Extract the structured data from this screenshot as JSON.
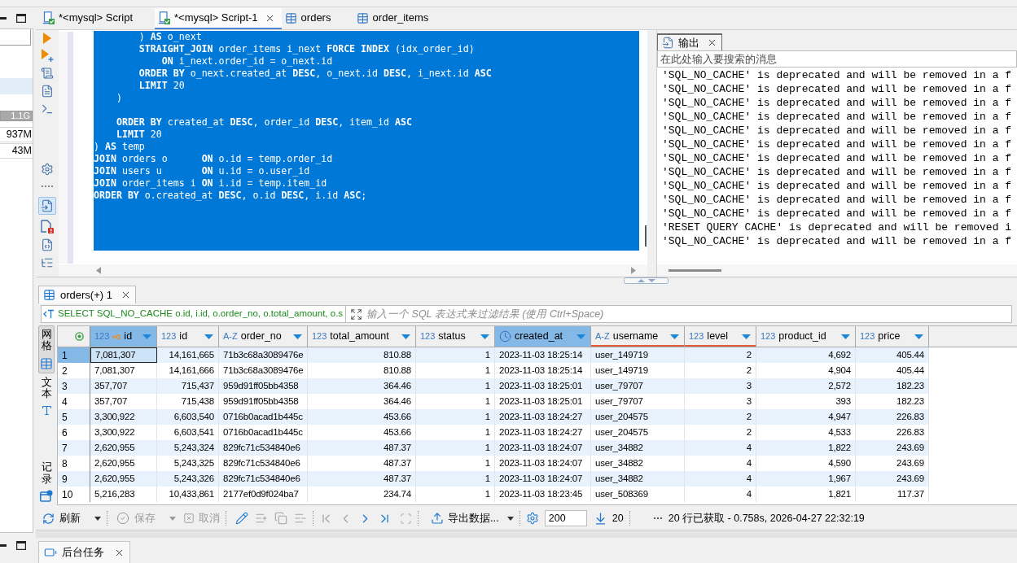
{
  "side_panel": {
    "list_rows": [
      {
        "selected": true
      }
    ],
    "memory": [
      {
        "text": "1.1G",
        "kind": "bar"
      },
      {
        "text": "937M",
        "kind": "value"
      },
      {
        "text": "43M",
        "kind": "value"
      }
    ]
  },
  "editor_tabs": [
    {
      "label": "*<mysql> Script",
      "kind": "script",
      "selected": false,
      "closable": false
    },
    {
      "label": "*<mysql> Script-1",
      "kind": "script",
      "selected": true,
      "closable": true
    },
    {
      "label": "orders",
      "kind": "table",
      "selected": false,
      "closable": false
    },
    {
      "label": "order_items",
      "kind": "table",
      "selected": false,
      "closable": false
    }
  ],
  "editor": {
    "output_toggle": {
      "on": true
    },
    "code_blocks": [
      [
        "        ) **AS** o_next",
        "        **STRAIGHT_JOIN** order_items i_next **FORCE INDEX** (idx_order_id)",
        "            **ON** i_next.order_id = o_next.id",
        "        **ORDER BY** o_next.created_at **DESC**, o_next.id **DESC**, i_next.id **ASC**",
        "        **LIMIT** 20",
        "    )"
      ],
      [
        "    **ORDER BY** created_at **DESC**, order_id **DESC**, item_id **ASC**",
        "    **LIMIT** 20",
        ") **AS** temp",
        "**JOIN** orders o      **ON** o.id = temp.order_id",
        "**JOIN** users u       **ON** u.id = o.user_id",
        "**JOIN** order_items i **ON** i.id = temp.item_id",
        "**ORDER BY** o.created_at **DESC**, o.id **DESC**, i.id **ASC**;"
      ]
    ]
  },
  "output_panel": {
    "tab": {
      "label": "输出",
      "selected": true
    },
    "search": {
      "placeholder": "在此处输入要搜索的消息"
    },
    "messages": [
      "'SQL_NO_CACHE' is deprecated and will be removed in a f",
      "'SQL_NO_CACHE' is deprecated and will be removed in a f",
      "'SQL_NO_CACHE' is deprecated and will be removed in a f",
      "'SQL_NO_CACHE' is deprecated and will be removed in a f",
      "'SQL_NO_CACHE' is deprecated and will be removed in a f",
      "'SQL_NO_CACHE' is deprecated and will be removed in a f",
      "'SQL_NO_CACHE' is deprecated and will be removed in a f",
      "'SQL_NO_CACHE' is deprecated and will be removed in a f",
      "'SQL_NO_CACHE' is deprecated and will be removed in a f",
      "'SQL_NO_CACHE' is deprecated and will be removed in a f",
      "'SQL_NO_CACHE' is deprecated and will be removed in a f",
      "'RESET QUERY CACHE' is deprecated and will be removed i",
      "'SQL_NO_CACHE' is deprecated and will be removed in a f"
    ]
  },
  "results": {
    "tab": {
      "label": "orders(+) 1",
      "selected": true
    },
    "query": "SELECT SQL_NO_CACHE o.id, i.id, o.order_no, o.total_amount, o.s",
    "filter": {
      "placeholder": "输入一个 SQL 表达式来过滤结果 (使用 Ctrl+Space)"
    },
    "view_tabs": [
      {
        "label": "网格",
        "selected": true
      },
      {
        "label": "文本",
        "selected": false
      },
      {
        "label": "记录",
        "selected": false
      }
    ],
    "columns": [
      {
        "label": "id",
        "kind": "number",
        "type_badge": "123",
        "primary_key": true,
        "selected": true,
        "focused": true
      },
      {
        "label": "id",
        "kind": "number",
        "type_badge": "123",
        "primary_key": false,
        "selected": false,
        "focused": false
      },
      {
        "label": "order_no",
        "kind": "string",
        "type_badge": "A-Z",
        "primary_key": false,
        "selected": false,
        "focused": false
      },
      {
        "label": "total_amount",
        "kind": "number",
        "type_badge": "123",
        "primary_key": false,
        "selected": false,
        "focused": false
      },
      {
        "label": "status",
        "kind": "number",
        "type_badge": "123",
        "primary_key": false,
        "selected": false,
        "focused": false
      },
      {
        "label": "created_at",
        "kind": "datetime",
        "primary_key": false,
        "selected": true,
        "focused": false
      },
      {
        "label": "username",
        "kind": "string",
        "type_badge": "A-Z",
        "primary_key": false,
        "selected": false,
        "focused": false,
        "color": "#e25b3c"
      },
      {
        "label": "level",
        "kind": "number",
        "type_badge": "123",
        "primary_key": false,
        "selected": false,
        "focused": false,
        "color": "#e25b3c"
      },
      {
        "label": "product_id",
        "kind": "number",
        "type_badge": "123",
        "primary_key": false,
        "selected": false,
        "focused": false
      },
      {
        "label": "price",
        "kind": "number",
        "type_badge": "123",
        "primary_key": false,
        "selected": false,
        "focused": false
      }
    ],
    "rows": [
      {
        "number": "1",
        "selected": true,
        "cells": [
          "7,081,307",
          "14,161,665",
          "71b3c68a3089476e",
          "810.88",
          "1",
          "2023-11-03 18:25:14",
          "user_149719",
          "2",
          "4,692",
          "405.44"
        ]
      },
      {
        "number": "2",
        "selected": false,
        "cells": [
          "7,081,307",
          "14,161,666",
          "71b3c68a3089476e",
          "810.88",
          "1",
          "2023-11-03 18:25:14",
          "user_149719",
          "2",
          "4,904",
          "405.44"
        ]
      },
      {
        "number": "3",
        "selected": false,
        "cells": [
          "357,707",
          "715,437",
          "959d91ff05bb4358",
          "364.46",
          "1",
          "2023-11-03 18:25:01",
          "user_79707",
          "3",
          "2,572",
          "182.23"
        ]
      },
      {
        "number": "4",
        "selected": false,
        "cells": [
          "357,707",
          "715,438",
          "959d91ff05bb4358",
          "364.46",
          "1",
          "2023-11-03 18:25:01",
          "user_79707",
          "3",
          "393",
          "182.23"
        ]
      },
      {
        "number": "5",
        "selected": false,
        "cells": [
          "3,300,922",
          "6,603,540",
          "0716b0acad1b445c",
          "453.66",
          "1",
          "2023-11-03 18:24:27",
          "user_204575",
          "2",
          "4,947",
          "226.83"
        ]
      },
      {
        "number": "6",
        "selected": false,
        "cells": [
          "3,300,922",
          "6,603,541",
          "0716b0acad1b445c",
          "453.66",
          "1",
          "2023-11-03 18:24:27",
          "user_204575",
          "2",
          "4,533",
          "226.83"
        ]
      },
      {
        "number": "7",
        "selected": false,
        "cells": [
          "2,620,955",
          "5,243,324",
          "829fc71c534840e6",
          "487.37",
          "1",
          "2023-11-03 18:24:07",
          "user_34882",
          "4",
          "1,822",
          "243.69"
        ]
      },
      {
        "number": "8",
        "selected": false,
        "cells": [
          "2,620,955",
          "5,243,325",
          "829fc71c534840e6",
          "487.37",
          "1",
          "2023-11-03 18:24:07",
          "user_34882",
          "4",
          "4,590",
          "243.69"
        ]
      },
      {
        "number": "9",
        "selected": false,
        "cells": [
          "2,620,955",
          "5,243,326",
          "829fc71c534840e6",
          "487.37",
          "1",
          "2023-11-03 18:24:07",
          "user_34882",
          "4",
          "1,967",
          "243.69"
        ]
      },
      {
        "number": "10",
        "selected": false,
        "cells": [
          "5,216,283",
          "10,433,861",
          "2177ef0d9f024ba7",
          "234.74",
          "1",
          "2023-11-03 18:23:45",
          "user_508369",
          "4",
          "1,821",
          "117.37"
        ]
      }
    ]
  },
  "toolbar": {
    "refresh": {
      "label": "刷新",
      "disabled": false
    },
    "save": {
      "label": "保存",
      "disabled": true
    },
    "cancel": {
      "label": "取消",
      "disabled": true
    },
    "row_actions": [
      {
        "disabled": false
      },
      {
        "disabled": true
      },
      {
        "disabled": true
      },
      {
        "disabled": true
      }
    ],
    "navigation": [
      {
        "disabled": true
      },
      {
        "disabled": true
      },
      {
        "disabled": false
      },
      {
        "disabled": false
      }
    ],
    "panels": {
      "disabled": true
    },
    "export": {
      "label": "导出数据..."
    },
    "fetch_size": {
      "value": "200"
    },
    "fetched_count": "20",
    "status": "20 行已获取 - 0.758s, 2026-04-27 22:32:19"
  },
  "bottom_panel": {
    "tabs": [
      {
        "label": "后台任务",
        "selected": true
      }
    ]
  }
}
